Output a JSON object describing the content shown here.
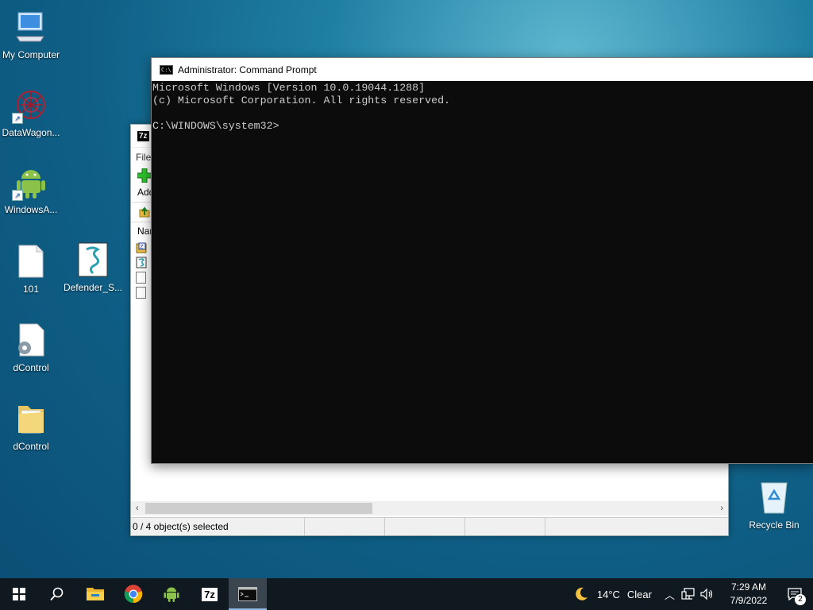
{
  "desktop": {
    "icons": [
      {
        "label": "My Computer"
      },
      {
        "label": "DataWagon..."
      },
      {
        "label": "WindowsA..."
      },
      {
        "label": "101"
      },
      {
        "label": "Defender_S..."
      },
      {
        "label": "dControl"
      },
      {
        "label": "dControl"
      },
      {
        "label": "Recycle Bin"
      }
    ]
  },
  "zip_window": {
    "logo": "7z",
    "menu_first": "File",
    "toolbar_add": "Add",
    "list_header": "Name",
    "status": "0 / 4 object(s) selected"
  },
  "cmd_window": {
    "title": "Administrator: Command Prompt",
    "line1": "Microsoft Windows [Version 10.0.19044.1288]",
    "line2": "(c) Microsoft Corporation. All rights reserved.",
    "prompt": "C:\\WINDOWS\\system32>"
  },
  "taskbar": {
    "apps": [
      "start-icon",
      "search-icon",
      "file-explorer-icon",
      "chrome-icon",
      "android-icon",
      "7zip-icon",
      "cmd-icon"
    ],
    "zip_label": "7z",
    "weather_temp": "14°C",
    "weather_desc": "Clear",
    "time": "7:29 AM",
    "date": "7/9/2022",
    "notifications": "2"
  }
}
